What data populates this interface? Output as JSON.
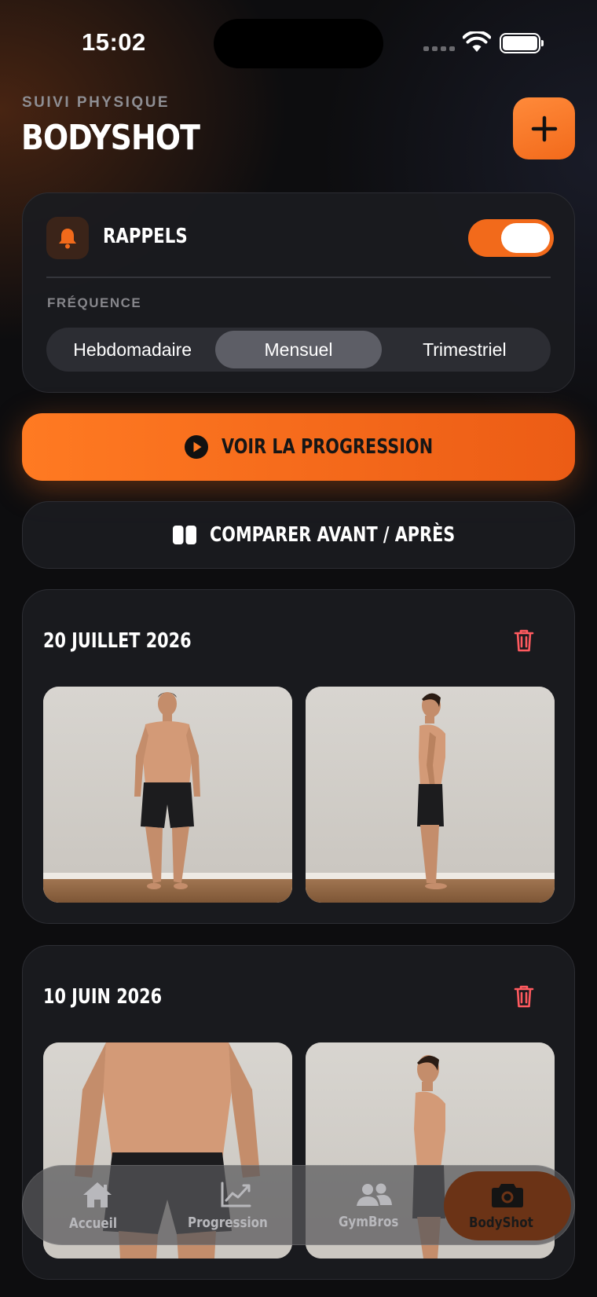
{
  "status_bar": {
    "time": "15:02"
  },
  "header": {
    "eyebrow": "SUIVI PHYSIQUE",
    "title": "BODYSHOT",
    "add_label": "+"
  },
  "reminders": {
    "label": "RAPPELS",
    "enabled": true,
    "frequency_label": "FRÉQUENCE",
    "options": [
      "Hebdomadaire",
      "Mensuel",
      "Trimestriel"
    ],
    "selected": "Mensuel"
  },
  "actions": {
    "progression_label": "VOIR LA PROGRESSION",
    "compare_label": "COMPARER AVANT / APRÈS"
  },
  "entries": [
    {
      "date": "20 JUILLET 2026",
      "photos": [
        "front-pose-photo",
        "side-pose-photo"
      ]
    },
    {
      "date": "10 JUIN 2026",
      "photos": [
        "front-pose-photo",
        "side-pose-photo"
      ]
    }
  ],
  "tabbar": {
    "items": [
      {
        "label": "Accueil",
        "icon": "home-icon"
      },
      {
        "label": "Progression",
        "icon": "chart-icon"
      },
      {
        "label": "GymBros",
        "icon": "people-icon"
      },
      {
        "label": "BodyShot",
        "icon": "camera-icon"
      }
    ],
    "active": "BodyShot"
  },
  "colors": {
    "accent": "#f26a1b",
    "background": "#0d0d0f",
    "card": "#1a1b20",
    "danger": "#ff5a5f"
  }
}
